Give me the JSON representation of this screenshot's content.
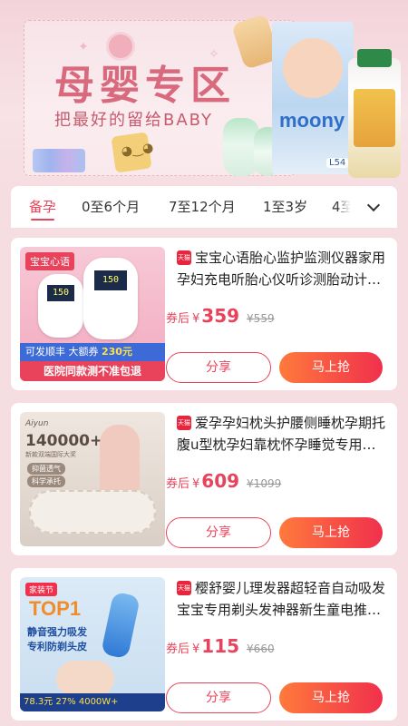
{
  "banner": {
    "title": "母婴专区",
    "subtitle": "把最好的留给BABY",
    "diaper_brand": "moony",
    "diaper_size": "L54"
  },
  "tabs": [
    {
      "label": "备孕",
      "active": true
    },
    {
      "label": "0至6个月",
      "active": false
    },
    {
      "label": "7至12个月",
      "active": false
    },
    {
      "label": "1至3岁",
      "active": false
    },
    {
      "label": "4至",
      "active": false
    }
  ],
  "more_icon": "chevron-down-icon",
  "accent_color": "#e8435a",
  "products": [
    {
      "mall_badge": "天猫",
      "title": "宝宝心语胎心监护监测仪器家用孕妇充电听胎心仪听诊测胎动计…",
      "price_label": "券后",
      "currency": "¥",
      "price": "359",
      "old_price": "¥559",
      "share_label": "分享",
      "buy_label": "马上抢",
      "thumb": {
        "brand": "宝宝心语",
        "screen_a": "150",
        "screen_b": "150",
        "strip1_a": "可发顺丰",
        "strip1_b": "大额券",
        "strip1_c": "230元",
        "strip2": "医院同款测不准包退"
      }
    },
    {
      "mall_badge": "天猫",
      "title": "爱孕孕妇枕头护腰侧睡枕孕期托腹u型枕孕妇靠枕怀孕睡觉专用…",
      "price_label": "券后",
      "currency": "¥",
      "price": "609",
      "old_price": "¥1099",
      "share_label": "分享",
      "buy_label": "马上抢",
      "thumb": {
        "logo": "Aiyun",
        "big": "140000+",
        "small": "新款双端国际大奖",
        "pill_a": "抑菌透气",
        "pill_b": "科学承托"
      }
    },
    {
      "mall_badge": "天猫",
      "title": "樱舒婴儿理发器超轻音自动吸发宝宝专用剃头发神器新生童电推…",
      "price_label": "券后",
      "currency": "¥",
      "price": "115",
      "old_price": "¥660",
      "share_label": "分享",
      "buy_label": "马上抢",
      "thumb": {
        "badge": "家装节",
        "top": "TOP1",
        "line_a": "静音强力吸发",
        "line_b": "专利防剃头皮",
        "bottom": "78.3元  27%  4000W+"
      }
    }
  ]
}
